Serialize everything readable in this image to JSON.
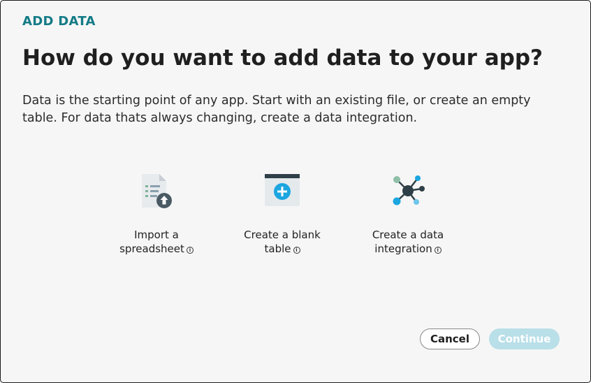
{
  "dialog": {
    "eyebrow": "ADD DATA",
    "title": "How do you want to add data to your app?",
    "description": "Data is the starting point of any app. Start with an existing file, or create an empty table. For data thats always changing, create a data integration."
  },
  "options": [
    {
      "line1": "Import a",
      "line2": "spreadsheet",
      "icon": "spreadsheet-upload-icon"
    },
    {
      "line1": "Create a blank",
      "line2": "table",
      "icon": "blank-table-add-icon"
    },
    {
      "line1": "Create a data",
      "line2": "integration",
      "icon": "data-integration-network-icon"
    }
  ],
  "info_glyph": "i",
  "buttons": {
    "cancel": "Cancel",
    "continue": "Continue"
  },
  "colors": {
    "accent": "#137b86",
    "continue_disabled_bg": "#b9dfe8",
    "icon_blue": "#1ba6e0",
    "icon_dark": "#2f3f48"
  }
}
